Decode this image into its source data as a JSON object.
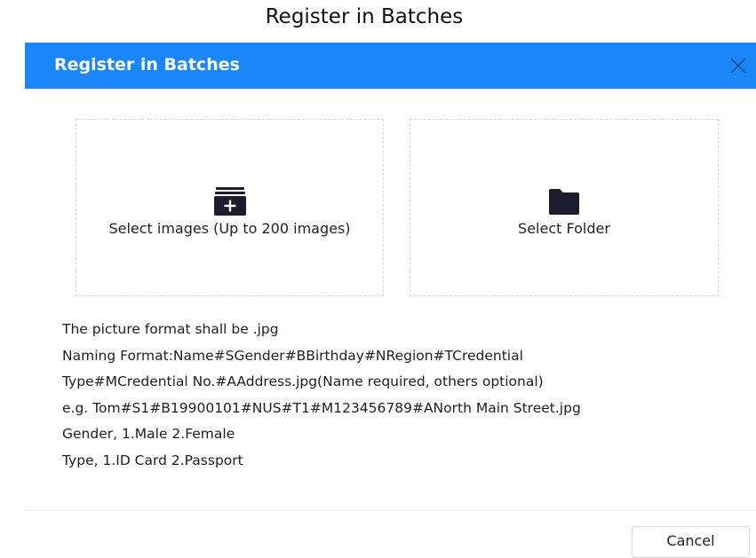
{
  "page_caption": "Register in Batches",
  "dialog": {
    "title": "Register in Batches",
    "close_icon": "close-icon",
    "accent_color": "#1a86f8",
    "select_images": {
      "label": "Select images (Up to 200 images)",
      "icon": "add-image-stack-icon"
    },
    "select_folder": {
      "label": "Select Folder",
      "icon": "folder-icon"
    },
    "instructions": [
      "The picture format shall be .jpg",
      "Naming Format:Name#SGender#BBirthday#NRegion#TCredential",
      "Type#MCredential No.#AAddress.jpg(Name required, others optional)",
      "e.g. Tom#S1#B19900101#NUS#T1#M123456789#ANorth Main Street.jpg",
      "Gender, 1.Male 2.Female",
      "Type, 1.ID Card 2.Passport"
    ],
    "cancel_label": "Cancel"
  }
}
